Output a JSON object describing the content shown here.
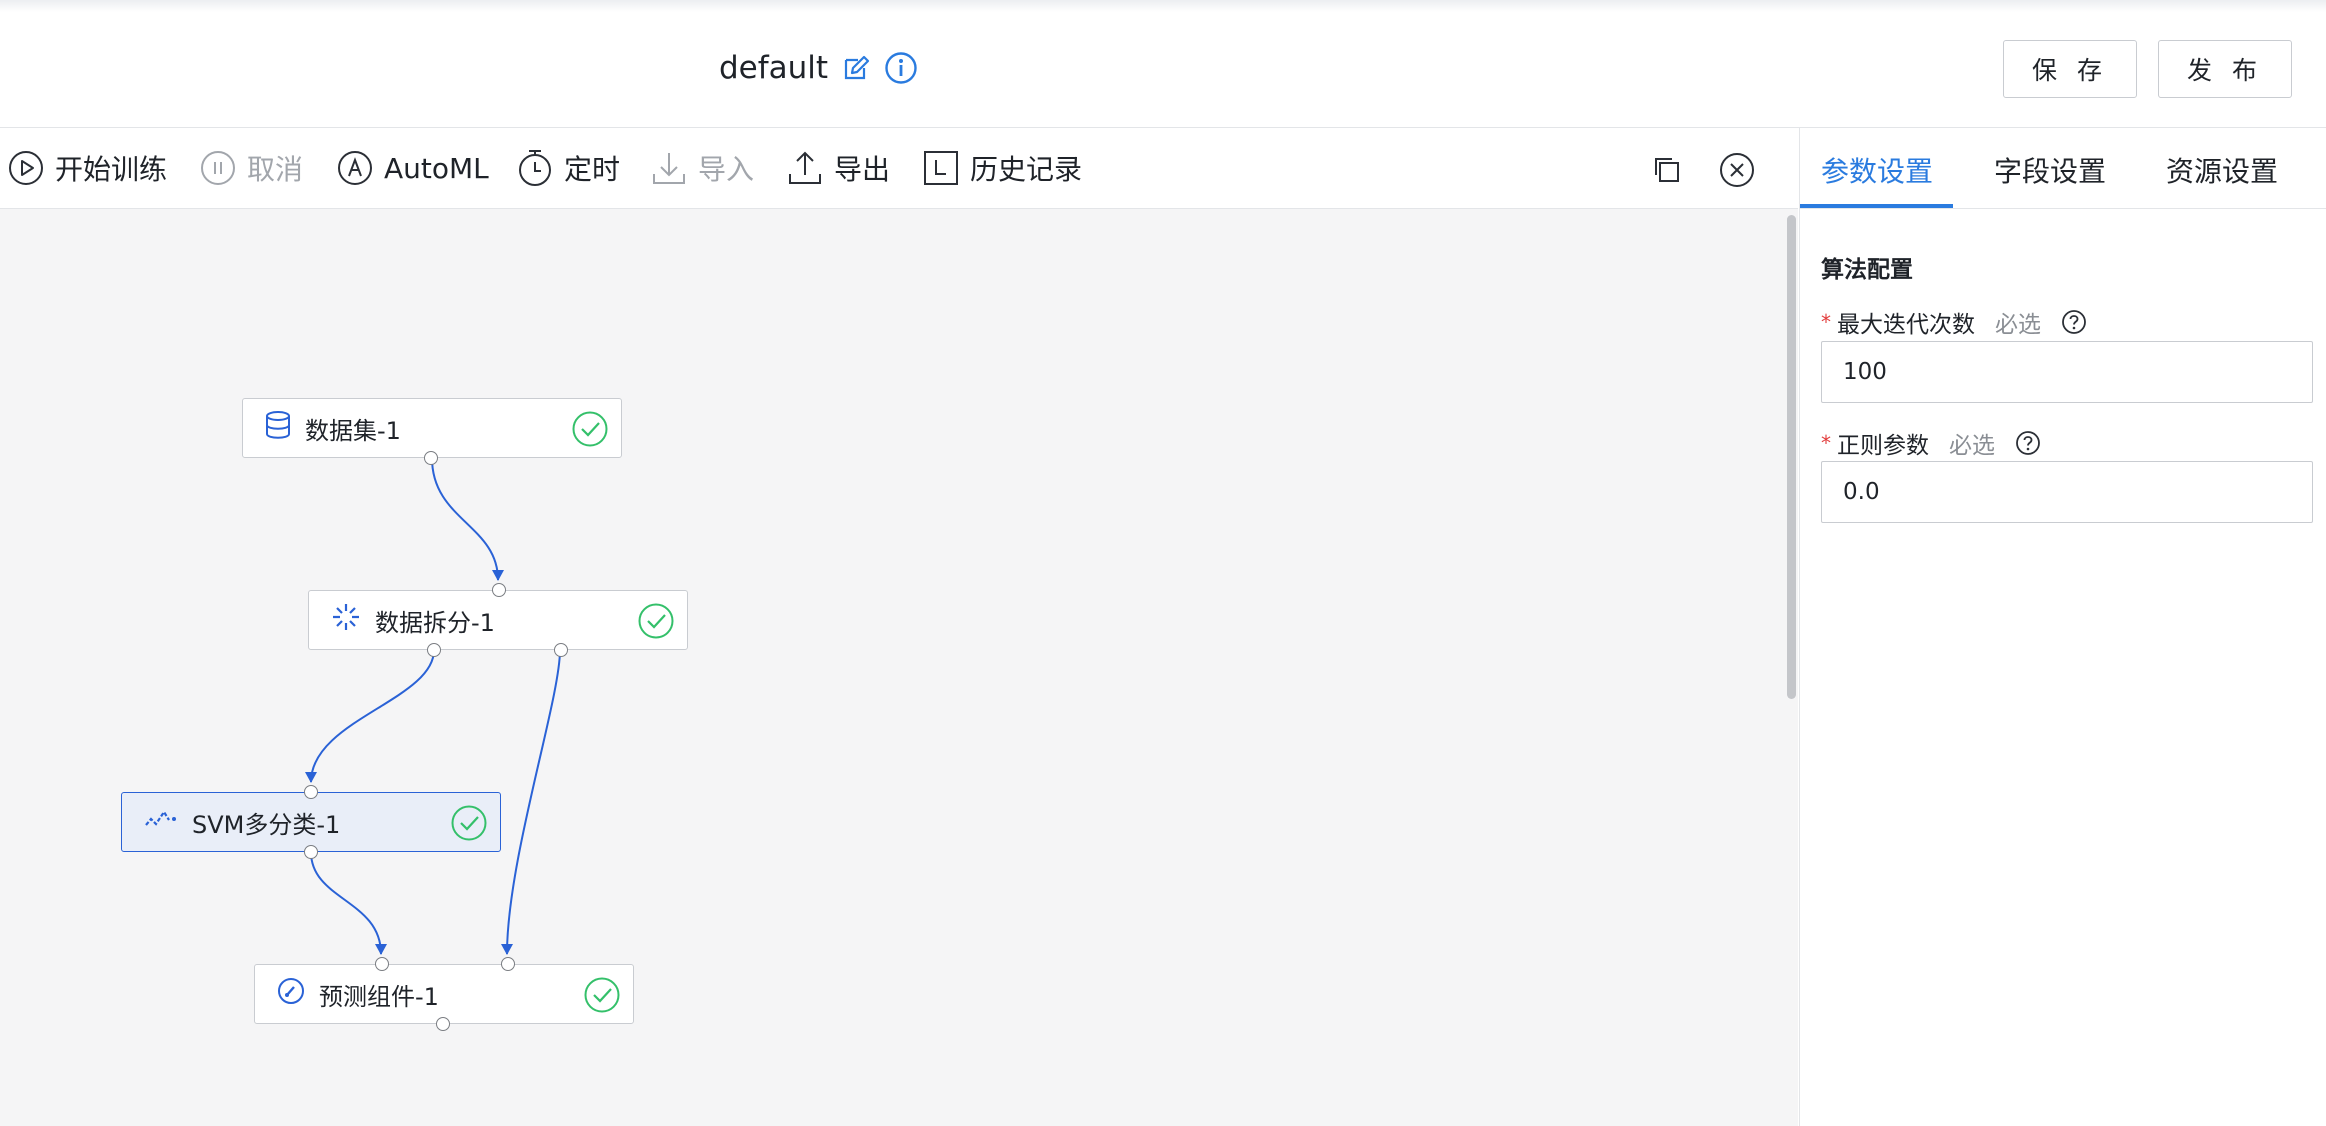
{
  "header": {
    "title": "default",
    "save_label": "保 存",
    "publish_label": "发 布",
    "icons": [
      "edit-icon",
      "info-icon"
    ]
  },
  "toolbar": {
    "items": [
      {
        "label": "开始训练",
        "icon": "play-icon",
        "enabled": true
      },
      {
        "label": "取消",
        "icon": "pause-icon",
        "enabled": false
      },
      {
        "label": "AutoML",
        "icon": "automl-icon",
        "enabled": true
      },
      {
        "label": "定时",
        "icon": "timer-icon",
        "enabled": true
      },
      {
        "label": "导入",
        "icon": "import-icon",
        "enabled": false
      },
      {
        "label": "导出",
        "icon": "export-icon",
        "enabled": true
      },
      {
        "label": "历史记录",
        "icon": "history-icon",
        "enabled": true
      }
    ],
    "right_icons": [
      "copy-icon",
      "close-icon"
    ]
  },
  "canvas": {
    "nodes": [
      {
        "label": "数据集-1",
        "icon": "database-icon",
        "status": "success",
        "selected": false
      },
      {
        "label": "数据拆分-1",
        "icon": "split-icon",
        "status": "success",
        "selected": false
      },
      {
        "label": "SVM多分类-1",
        "icon": "svm-icon",
        "status": "success",
        "selected": true
      },
      {
        "label": "预测组件-1",
        "icon": "gauge-icon",
        "status": "success",
        "selected": false
      }
    ],
    "edges": [
      {
        "from": "数据集-1",
        "to": "数据拆分-1"
      },
      {
        "from": "数据拆分-1",
        "to": "SVM多分类-1"
      },
      {
        "from": "数据拆分-1",
        "to": "预测组件-1"
      },
      {
        "from": "SVM多分类-1",
        "to": "预测组件-1"
      }
    ]
  },
  "panel": {
    "tabs": [
      {
        "label": "参数设置",
        "active": true
      },
      {
        "label": "字段设置",
        "active": false
      },
      {
        "label": "资源设置",
        "active": false
      }
    ],
    "section_title": "算法配置",
    "fields": [
      {
        "required_mark": "*",
        "label": "最大迭代次数",
        "hint": "必选",
        "value": "100"
      },
      {
        "required_mark": "*",
        "label": "正则参数",
        "hint": "必选",
        "value": "0.0"
      }
    ]
  },
  "colors": {
    "accent": "#2a7bdf",
    "edge": "#2a62d6",
    "success": "#34c06a",
    "required": "#e23c3c",
    "canvas_bg": "#f5f5f6"
  }
}
